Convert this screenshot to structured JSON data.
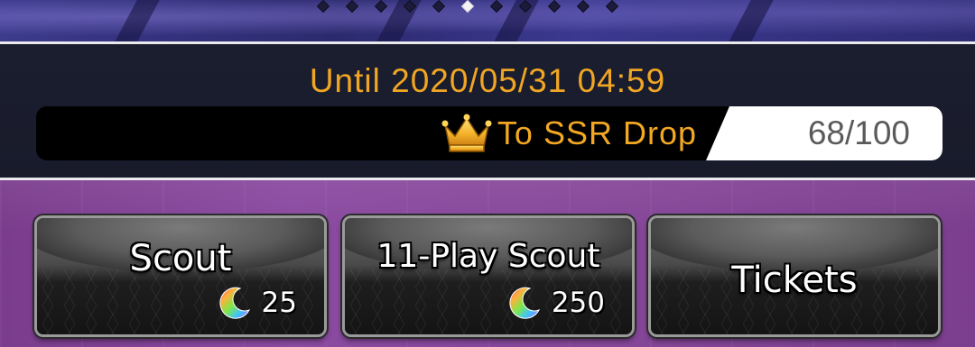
{
  "carousel": {
    "dot_count": 11,
    "active_index": 5
  },
  "banner": {
    "until_text": "Until 2020/05/31 04:59",
    "ssr_label": "To SSR Drop",
    "ssr_count": "68/100"
  },
  "buttons": [
    {
      "label": "Scout",
      "cost": "25",
      "cost_icon": "rainbow-moon-icon"
    },
    {
      "label": "11-Play Scout",
      "cost": "250",
      "cost_icon": "rainbow-moon-icon"
    },
    {
      "label": "Tickets"
    }
  ],
  "colors": {
    "accent_orange": "#f0a623",
    "panel_navy": "#1b1e2f",
    "button_area_purple": "#864799"
  }
}
